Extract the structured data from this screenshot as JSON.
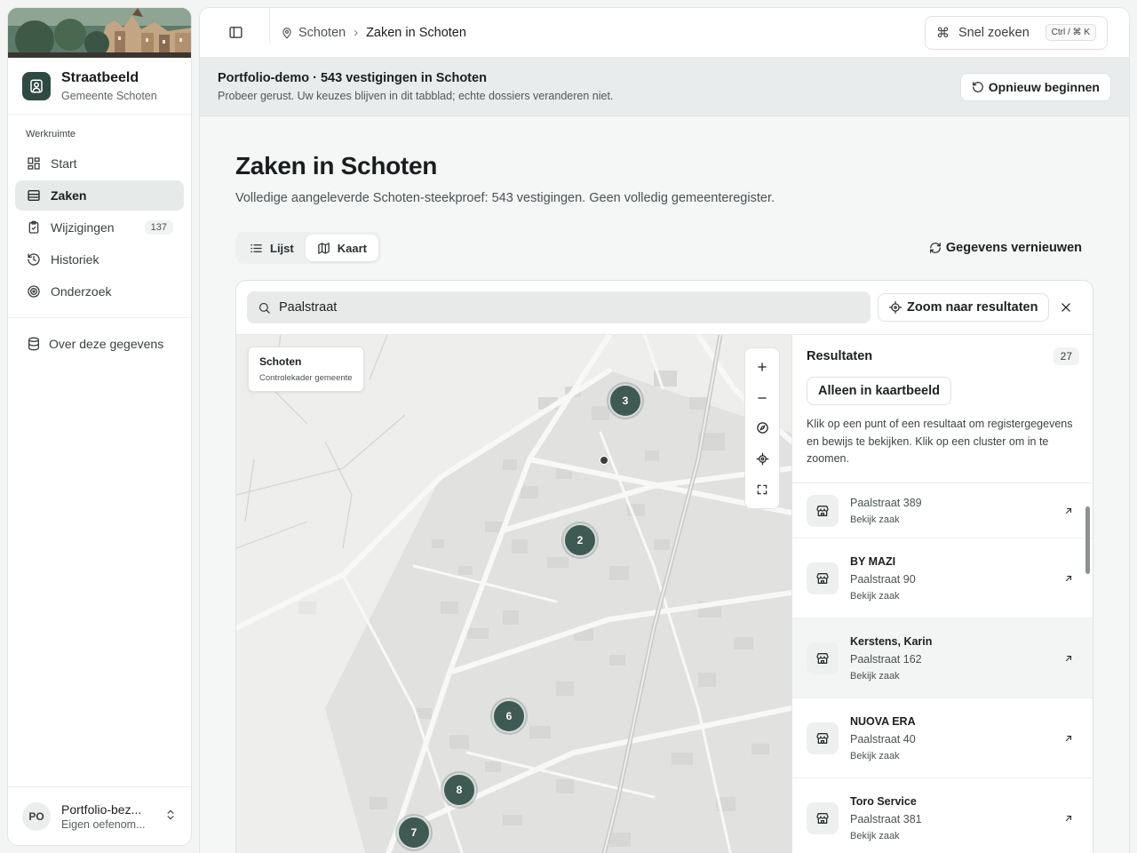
{
  "sidebar": {
    "brand_title": "Straatbeeld",
    "brand_sub": "Gemeente Schoten",
    "section_heading": "Werkruimte",
    "items": [
      {
        "label": "Start",
        "icon": "dashboard-icon"
      },
      {
        "label": "Zaken",
        "icon": "list-icon",
        "active": true
      },
      {
        "label": "Wijzigingen",
        "icon": "clipboard-check-icon",
        "badge": "137"
      },
      {
        "label": "Historiek",
        "icon": "history-icon"
      },
      {
        "label": "Onderzoek",
        "icon": "radar-icon"
      }
    ],
    "extra_item": "Over deze gegevens",
    "user": {
      "initials": "PO",
      "name": "Portfolio-bez...",
      "sub": "Eigen oefenom..."
    }
  },
  "topbar": {
    "crumbs": [
      "Schoten",
      "Zaken in Schoten"
    ],
    "quick_search": "Snel zoeken",
    "shortcut": "Ctrl / ⌘ K"
  },
  "banner": {
    "title": "Portfolio-demo · 543 vestigingen in Schoten",
    "sub": "Probeer gerust. Uw keuzes blijven in dit tabblad; echte dossiers veranderen niet.",
    "restart": "Opnieuw beginnen"
  },
  "page": {
    "title": "Zaken in Schoten",
    "sub": "Volledige aangeleverde Schoten-steekproef: 543 vestigingen. Geen volledig gemeenteregister.",
    "tabs": [
      {
        "label": "Lijst"
      },
      {
        "label": "Kaart",
        "active": true
      }
    ],
    "refresh": "Gegevens vernieuwen"
  },
  "map": {
    "search_value": "Paalstraat",
    "zoom_results": "Zoom naar resultaten",
    "label_title": "Schoten",
    "label_sub": "Controlekader gemeente",
    "clusters": [
      "3",
      "2",
      "6",
      "8",
      "7"
    ]
  },
  "results": {
    "title": "Resultaten",
    "count": "27",
    "only_view": "Alleen in kaartbeeld",
    "help": "Klik op een punt of een resultaat om registergegevens en bewijs te bekijken. Klik op een cluster om in te zoomen.",
    "items": [
      {
        "name": "",
        "addr": "Paalstraat 389",
        "link": "Bekijk zaak"
      },
      {
        "name": "BY MAZI",
        "addr": "Paalstraat 90",
        "link": "Bekijk zaak"
      },
      {
        "name": "Kerstens, Karin",
        "addr": "Paalstraat 162",
        "link": "Bekijk zaak"
      },
      {
        "name": "NUOVA ERA",
        "addr": "Paalstraat 40",
        "link": "Bekijk zaak"
      },
      {
        "name": "Toro Service",
        "addr": "Paalstraat 381",
        "link": "Bekijk zaak"
      }
    ]
  }
}
